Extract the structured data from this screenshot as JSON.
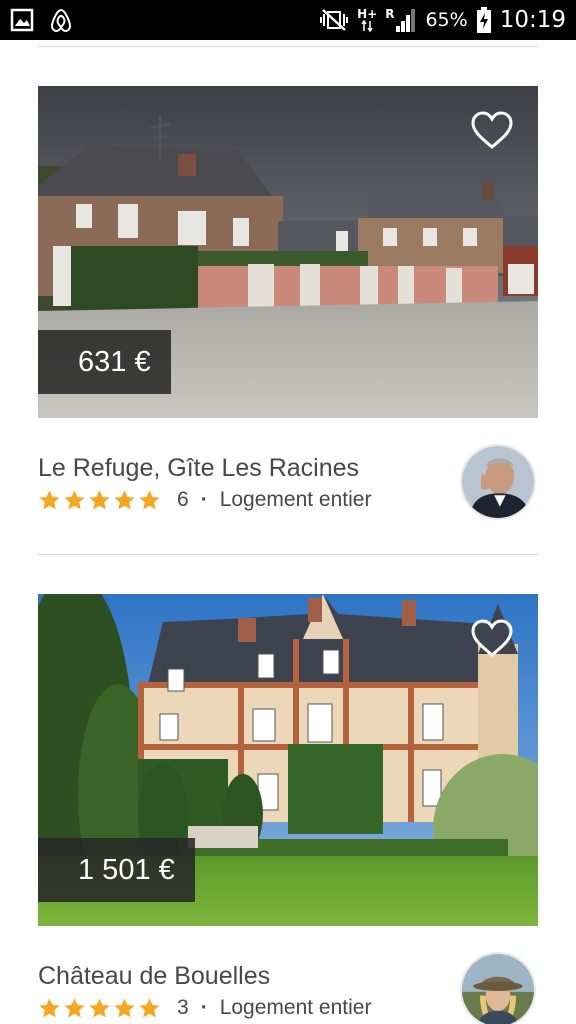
{
  "status_bar": {
    "network": "H+",
    "roaming": "R",
    "battery": "65%",
    "time": "10:19"
  },
  "listings": [
    {
      "price": "631 €",
      "title": "Le Refuge, Gîte Les Racines",
      "rating": 5,
      "reviews": "6",
      "separator": "·",
      "type": "Logement entier"
    },
    {
      "price": "1 501 €",
      "title": "Château de Bouelles",
      "rating": 5,
      "reviews": "3",
      "separator": "·",
      "type": "Logement entier"
    }
  ],
  "colors": {
    "star": "#f5a623",
    "text": "#484848",
    "price_bg": "#282828"
  }
}
